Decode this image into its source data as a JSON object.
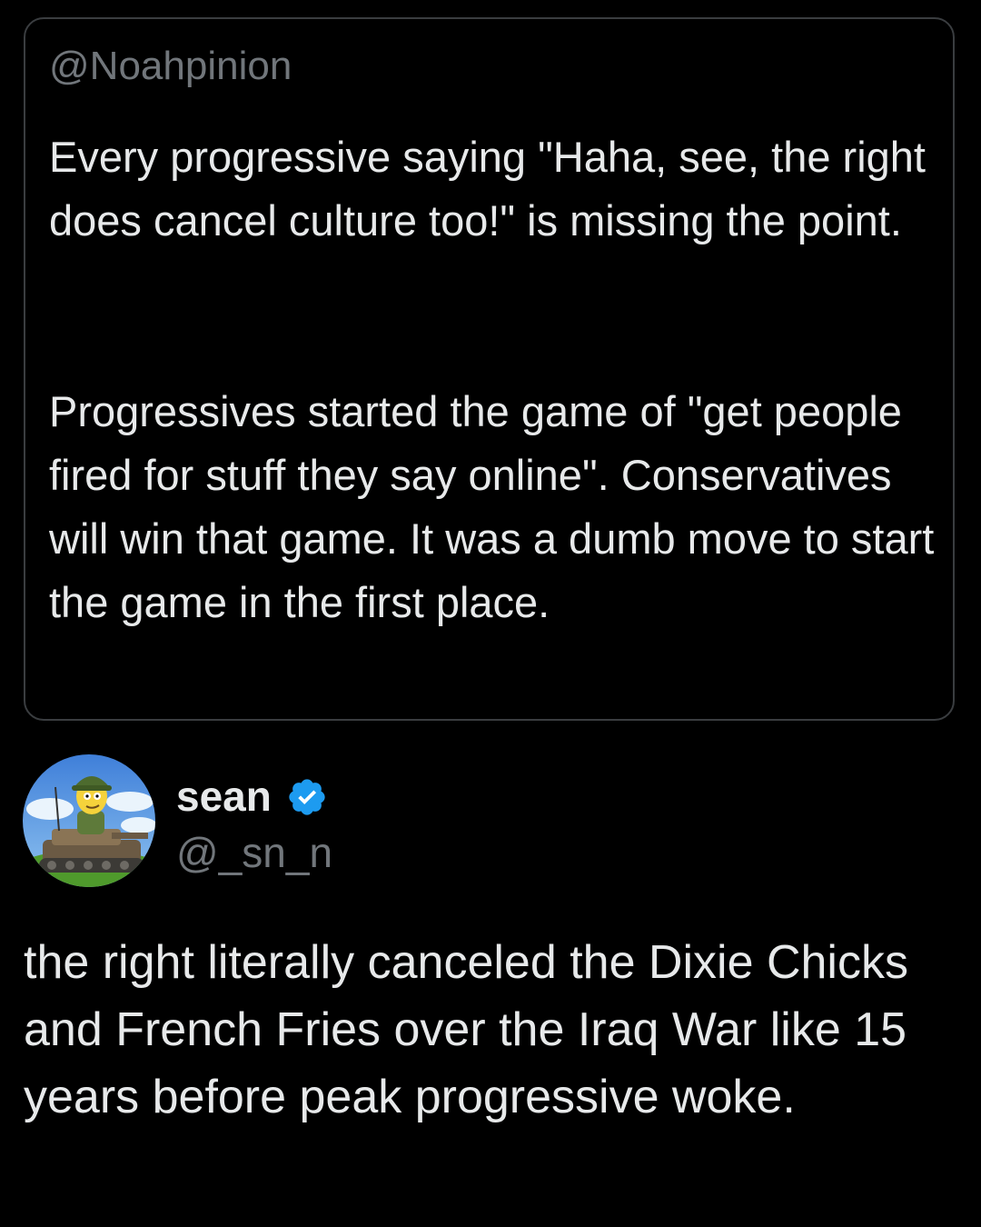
{
  "quoted_tweet": {
    "handle": "@Noahpinion",
    "paragraphs": [
      "Every progressive saying \"Haha, see, the right does cancel culture too!\" is missing the point.",
      "Progressives started the game of \"get people fired for stuff they say online\". Conservatives will win that game. It was a dumb move to start the game in the first place."
    ]
  },
  "reply_tweet": {
    "author_name": "sean",
    "author_handle": "@_sn_n",
    "verified_icon": "verified-check-icon",
    "avatar_icon": "cartoon-soldier-on-tank-avatar",
    "text": "the right literally canceled the Dixie Chicks and French Fries over the Iraq War like 15 years before peak progressive woke."
  },
  "colors": {
    "background": "#000000",
    "text_primary": "#e7e9ea",
    "text_secondary": "#71767b",
    "card_border": "#3a3d40",
    "verified_blue": "#1d9bf0"
  }
}
